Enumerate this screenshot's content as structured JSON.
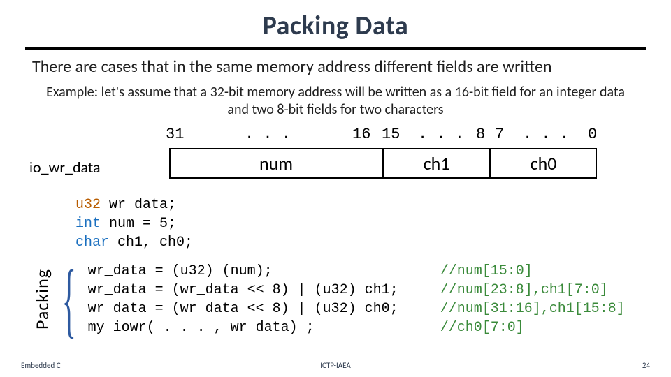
{
  "title": "Packing Data",
  "subtitle": "There are cases that in the same memory address different fields are written",
  "example": "Example: let's assume that a 32-bit memory address will be written as a 16-bit field for an integer data and two 8-bit fields for two characters",
  "bits": {
    "b31": "31",
    "dots1": ". . .",
    "b16": "16",
    "b15": "15",
    "dots2": ". . .",
    "b8": "8",
    "b7": "7",
    "dots3": ". . .",
    "b0": "0"
  },
  "io_label": "io_wr_data",
  "fields": {
    "num": "num",
    "ch1": "ch1",
    "ch0": "ch0"
  },
  "decl": {
    "l1_u32": "u32",
    "l1_rest": " wr_data;",
    "l2_int": "int",
    "l2_rest": " num = 5;",
    "l3_char": "char",
    "l3_rest": " ch1, ch0;"
  },
  "pack_label": "Packing",
  "packcode": {
    "l1": "wr_data = (u32) (num);                    ",
    "l1c": "//num[15:0]",
    "l2": "wr_data = (wr_data << 8) | (u32) ch1;     ",
    "l2c": "//num[23:8],ch1[7:0]",
    "l3": "wr_data = (wr_data << 8) | (u32) ch0;     ",
    "l3c": "//num[31:16],ch1[15:8]",
    "l4": "my_iowr( . . . , wr_data) ;               ",
    "l4c": "//ch0[7:0]"
  },
  "footer": {
    "left": "Embedded C",
    "center": "ICTP-IAEA",
    "right": "24"
  }
}
